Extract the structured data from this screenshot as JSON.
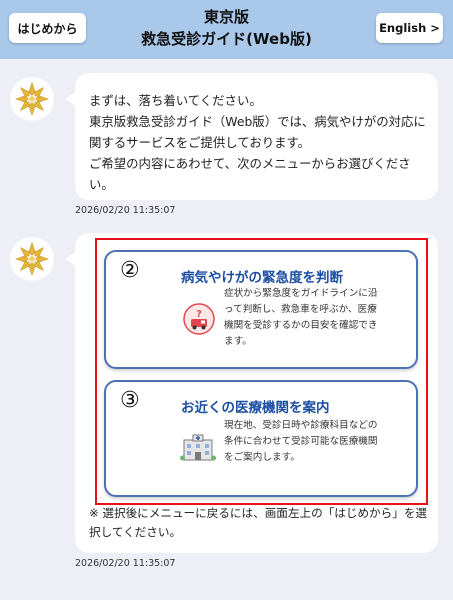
{
  "header": {
    "start_button": "はじめから",
    "title_line1": "東京版",
    "title_line2": "救急受診ガイド(Web版)",
    "language_button": "English >"
  },
  "chat": {
    "message1": {
      "lines": [
        "まずは、落ち着いてください。",
        "東京版救急受診ガイド（Web版）では、病気やけがの対応に関するサービスをご提供しております。",
        "ご希望の内容にあわせて、次のメニューからお選びください。"
      ],
      "timestamp": "2026/02/20 11:35:07"
    },
    "message2": {
      "menu": [
        {
          "number": "②",
          "title": "病気やけがの緊急度を判断",
          "description": "症状から緊急度をガイドラインに沿って判断し、救急車を呼ぶか、医療機関を受診するかの目安を確認できます。",
          "icon": "ambulance-question-icon"
        },
        {
          "number": "③",
          "title": "お近くの医療機関を案内",
          "description": "現在地、受診日時や診療科目などの条件に合わせて受診可能な医療機関をご案内します。",
          "icon": "hospital-building-icon"
        }
      ],
      "note": "※ 選択後にメニューに戻るには、画面左上の「はじめから」を選択してください。",
      "timestamp": "2026/02/20 11:35:07"
    }
  },
  "colors": {
    "header_bg": "#a9c8ea",
    "page_bg": "#eeeef7",
    "card_border": "#4d72b4",
    "card_title": "#1d4fa3",
    "highlight_frame": "#e8111b",
    "avatar_gold": "#e2b53a"
  }
}
